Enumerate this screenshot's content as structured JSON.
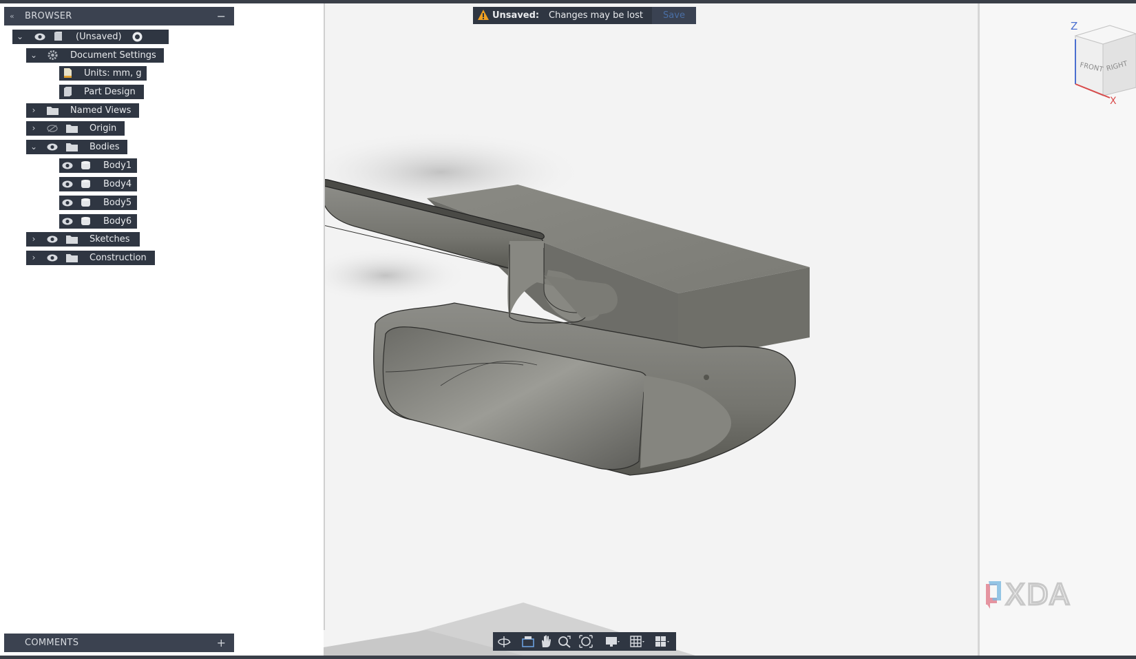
{
  "browser": {
    "title": "BROWSER",
    "collapse_glyph": "«",
    "minimize_glyph": "−",
    "nodes": [
      {
        "label": "(Unsaved)",
        "icon": "document-icon"
      },
      {
        "label": "Document Settings",
        "icon": "gear-icon"
      },
      {
        "label": "Units: mm, g",
        "icon": "units-icon"
      },
      {
        "label": "Part Design",
        "icon": "part-design-icon"
      },
      {
        "label": "Named Views",
        "icon": "folder-icon"
      },
      {
        "label": "Origin",
        "icon": "folder-icon"
      },
      {
        "label": "Bodies",
        "icon": "folder-icon"
      },
      {
        "label": "Body1",
        "icon": "body-icon"
      },
      {
        "label": "Body4",
        "icon": "body-icon"
      },
      {
        "label": "Body5",
        "icon": "body-icon"
      },
      {
        "label": "Body6",
        "icon": "body-icon"
      },
      {
        "label": "Sketches",
        "icon": "folder-icon"
      },
      {
        "label": "Construction",
        "icon": "folder-icon"
      }
    ]
  },
  "comments": {
    "title": "COMMENTS",
    "add_glyph": "+"
  },
  "banner": {
    "status": "Unsaved:",
    "message": "Changes may be lost",
    "save_label": "Save"
  },
  "viewcube": {
    "front": "FRONT",
    "right": "RIGHT",
    "z_axis": "Z",
    "x_axis": "X"
  },
  "watermark": "XDA",
  "colors": {
    "panel_bg": "#2f3642",
    "header_bg": "#3b4250",
    "model_gray": "#7a7a74",
    "viewport_bg": "#f3f3f3"
  }
}
